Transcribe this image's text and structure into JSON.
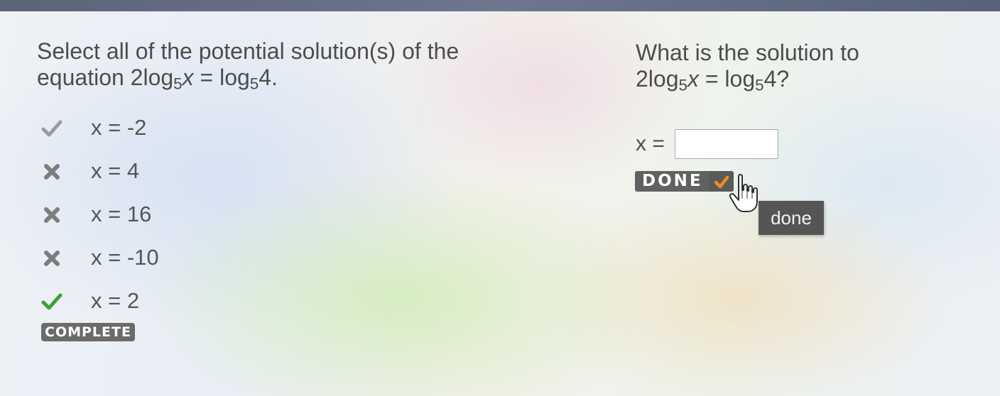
{
  "question1": {
    "prompt_line1": "Select all of the potential solution(s) of the",
    "prompt_line2_prefix": "equation ",
    "equation": {
      "lhs_coef": "2log",
      "base": "5",
      "var": "x",
      "eq": " = log",
      "rhs_base": "5",
      "rhs_arg": "4",
      "end": "."
    },
    "options": [
      {
        "text": "x = -2",
        "mark": "check-gray"
      },
      {
        "text": "x = 4",
        "mark": "x-gray"
      },
      {
        "text": "x = 16",
        "mark": "x-gray"
      },
      {
        "text": "x = -10",
        "mark": "x-gray"
      },
      {
        "text": "x = 2",
        "mark": "check-green"
      }
    ],
    "status_badge": "COMPLETE"
  },
  "question2": {
    "prompt_line1": "What is the solution to",
    "equation": {
      "lhs_coef": "2log",
      "base": "5",
      "var": "x",
      "eq": " = log",
      "rhs_base": "5",
      "rhs_arg": "4",
      "end": "?"
    },
    "answer_label": "x =",
    "answer_value": "",
    "done_button": "DONE",
    "tooltip": "done"
  },
  "colors": {
    "check_green": "#3aa135",
    "mark_gray": "#8a8a8a",
    "badge_bg": "#6b6b6b",
    "done_check_orange": "#f08a1c"
  }
}
